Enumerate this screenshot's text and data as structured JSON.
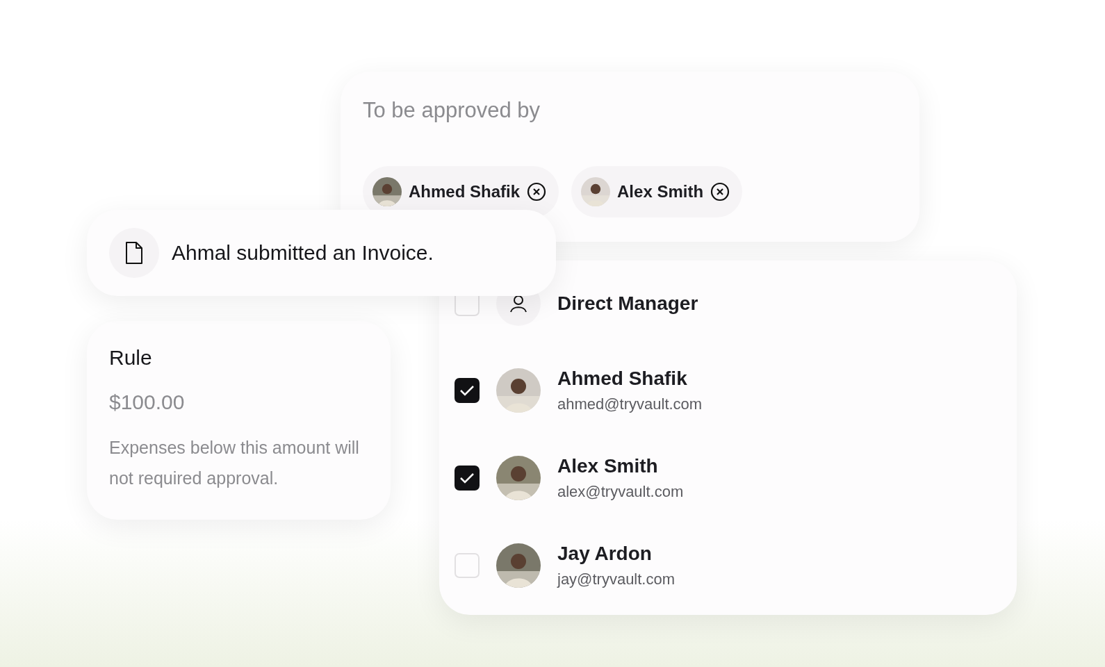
{
  "approvers": {
    "title": "To be approved by",
    "chips": [
      {
        "name": "Ahmed Shafik"
      },
      {
        "name": "Alex Smith"
      }
    ]
  },
  "notification": {
    "text": "Ahmal submitted an Invoice."
  },
  "rule": {
    "title": "Rule",
    "amount": "$100.00",
    "description": "Expenses below this amount will not required approval."
  },
  "people": [
    {
      "kind": "role",
      "name": "Direct Manager",
      "checked": false
    },
    {
      "kind": "person",
      "name": "Ahmed Shafik",
      "email": "ahmed@tryvault.com",
      "checked": true
    },
    {
      "kind": "person",
      "name": "Alex Smith",
      "email": "alex@tryvault.com",
      "checked": true
    },
    {
      "kind": "person",
      "name": "Jay Ardon",
      "email": "jay@tryvault.com",
      "checked": false
    }
  ]
}
